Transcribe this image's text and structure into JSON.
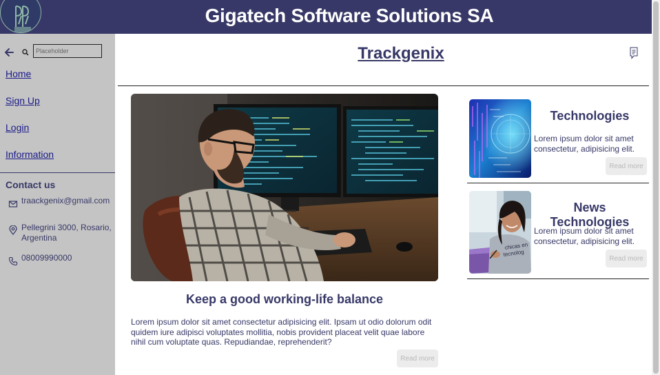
{
  "header": {
    "title": "Gigatech Software Solutions SA",
    "logo_icon": "logo-icon",
    "background": "#373867"
  },
  "sidebar": {
    "back_icon": "arrow-left-icon",
    "search": {
      "placeholder": "Placeholder",
      "value": "",
      "icon": "search-icon"
    },
    "nav": [
      {
        "label": "Home"
      },
      {
        "label": "Sign Up"
      },
      {
        "label": "Login"
      },
      {
        "label": "Information"
      }
    ],
    "contact": {
      "title": "Contact us",
      "email": "traackgenix@gmail.com",
      "address": "Pellegrini 3000, Rosario, Argentina",
      "phone": "08009990000"
    },
    "background": "#c4c4c4"
  },
  "main": {
    "title": "Trackgenix",
    "note_icon": "note-icon",
    "hero": {
      "title": "Keep a good working-life balance",
      "text": "Lorem ipsum dolor sit amet consectetur adipisicing elit. Ipsam ut odio dolorum odit quidem iure adipisci voluptates mollitia, nobis provident placeat velit quae labore nihil cum voluptate quas. Repudiandae, reprehenderit?",
      "button": "Read more"
    },
    "cards": [
      {
        "title": "Technologies",
        "text": "Lorem ipsum dolor sit amet consectetur, adipisicing elit.",
        "button": "Read more"
      },
      {
        "title": "News Technologies",
        "text": "Lorem ipsum dolor sit amet consectetur, adipisicing elit.",
        "button": "Read more"
      }
    ]
  },
  "colors": {
    "accent": "#373867",
    "link": "#1a1a8a",
    "button_bg": "#ececec",
    "button_text": "#b9b9b9"
  }
}
